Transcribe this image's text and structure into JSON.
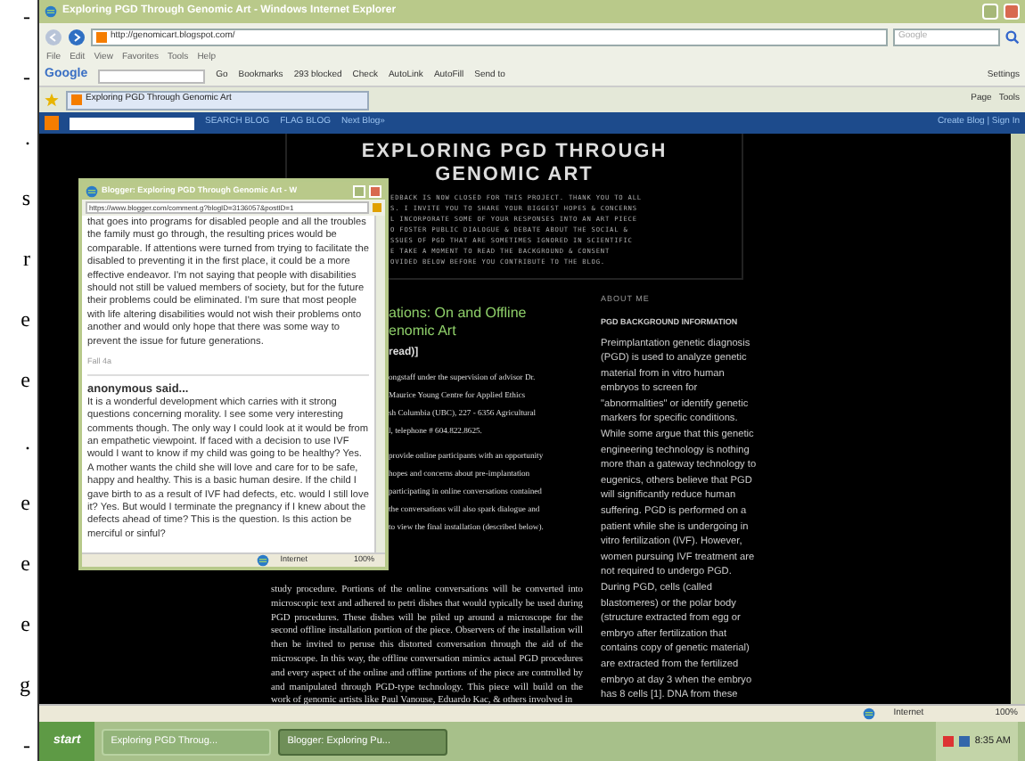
{
  "margin_fragments": [
    "-",
    "-",
    ".",
    "s",
    "r",
    "e",
    "e",
    ".",
    "e",
    "e",
    "e",
    "g",
    "-"
  ],
  "browser": {
    "title": "Exploring PGD Through Genomic Art - Windows Internet Explorer",
    "address": "http://genomicart.blogspot.com/",
    "search_placeholder": "Google",
    "menu": [
      "File",
      "Edit",
      "View",
      "Favorites",
      "Tools",
      "Help"
    ],
    "toolbar": {
      "brand": "Google",
      "items": [
        "Go",
        "Bookmarks",
        "293 blocked",
        "Check",
        "AutoLink",
        "AutoFill",
        "Send to"
      ],
      "settings": "Settings"
    },
    "tab": {
      "label": "Exploring PGD Through Genomic Art"
    },
    "commands": [
      "Page",
      "Tools"
    ]
  },
  "blogger_bar": {
    "items": [
      "SEARCH BLOG",
      "FLAG BLOG",
      "Next Blog»"
    ],
    "right": "Create Blog | Sign In"
  },
  "blog": {
    "title": "EXPLORING PGD THROUGH GENOMIC ART",
    "description_lines": [
      "EDBACK IS NOW CLOSED FOR THIS PROJECT. THANK YOU TO ALL",
      "S. I INVITE YOU TO SHARE YOUR BIGGEST HOPES & CONCERNS",
      "L INCORPORATE SOME OF YOUR RESPONSES INTO AN ART PIECE",
      "O FOSTER PUBLIC DIALOGUE & DEBATE ABOUT THE SOCIAL &",
      "SSUES OF PGD THAT ARE SOMETIMES IGNORED IN SCIENTIFIC",
      "E TAKE A MOMENT TO READ THE BACKGROUND & CONSENT",
      "OVIDED BELOW BEFORE YOU CONTRIBUTE TO THE BLOG."
    ],
    "post_title_lines": [
      "ations: On and Offline",
      "enomic Art"
    ],
    "post_meta": "read)]",
    "post_upper_paragraphs": [
      [
        "ongstaff under the supervision of advisor Dr.",
        "Maurice Young Centre for Applied Ethics",
        "sh Columbia (UBC), 227 - 6356 Agricultural",
        "l, telephone # 604.822.8625."
      ],
      [
        "provide online participants with an opportunity",
        "hopes and concerns about pre-implantation",
        "participating in online conversations contained",
        "the conversations will also spark dialogue and",
        "to view the final installation (described below)."
      ]
    ],
    "post_lower": "study procedure. Portions of the online conversations will be converted into microscopic text and adhered to petri dishes that would typically be used during PGD procedures. These dishes will be piled up around a microscope for the second offline installation portion of the piece. Observers of the installation will then be invited to peruse this distorted conversation through the aid of the microscope. In this way, the offline conversation mimics actual PGD procedures and every aspect of the online and offline portions of the piece are controlled by and manipulated through PGD-type technology. This piece will build on the work of genomic artists like Paul Vanouse, Eduardo Kac, & others involved in",
    "sidebar": {
      "heading": "ABOUT ME",
      "subheading": "PGD BACKGROUND INFORMATION",
      "text": "Preimplantation genetic diagnosis (PGD) is used to analyze genetic material from in vitro human embryos to screen for \"abnormalities\" or identify genetic markers for specific conditions. While some argue that this genetic engineering technology is nothing more than a gateway technology to eugenics, others believe that PGD will significantly reduce human suffering. PGD is performed on a patient while she is undergoing in vitro fertilization (IVF). However, women pursuing IVF treatment are not required to undergo PGD. During PGD, cells (called blastomeres) or the polar body (structure extracted from egg or embryo after fertilization that contains copy of genetic material) are extracted from the fertilized embryo at day 3 when the embryo has 8 cells [1]. DNA from these"
    }
  },
  "popup": {
    "title": "Blogger: Exploring PGD Through Genomic Art - W",
    "address": "https://www.blogger.com/comment.g?blogID=3136057&postID=1",
    "comments": [
      {
        "body": "that goes into programs for disabled people and all the troubles the family must go through, the resulting prices would be comparable. If attentions were turned from trying to facilitate the disabled to preventing it in the first place, it could be a more effective endeavor. I'm not saying that people with disabilities should not still be valued members of society, but for the future their problems could be eliminated. I'm sure that most people with life altering disabilities would not wish their problems onto another and would only hope that there was some way to prevent the issue for future generations.",
        "date": "Fall 4a"
      },
      {
        "author": "anonymous said...",
        "body": "It is a wonderful development which carries with it strong questions concerning morality. I see some very interesting comments though. The only way I could look at it would be from an empathetic viewpoint. If faced with a decision to use IVF would I want to know if my child was going to be healthy? Yes. A mother wants the child she will love and care for to be safe, happy and healthy. This is a basic human desire. If the child I gave birth to as a result of IVF had defects, etc. would I still love it? Yes. But would I terminate the pregnancy if I knew about the defects ahead of time? This is the question. Is this action be merciful or sinful?"
      }
    ],
    "status": {
      "zone": "Internet",
      "zoom": "100%"
    }
  },
  "status": {
    "zone": "Internet",
    "zoom": "100%"
  },
  "taskbar": {
    "start": "start",
    "tasks": [
      {
        "label": "Exploring PGD Throug...",
        "selected": false
      },
      {
        "label": "Blogger: Exploring Pu...",
        "selected": true
      }
    ],
    "clock": "8:35 AM"
  }
}
